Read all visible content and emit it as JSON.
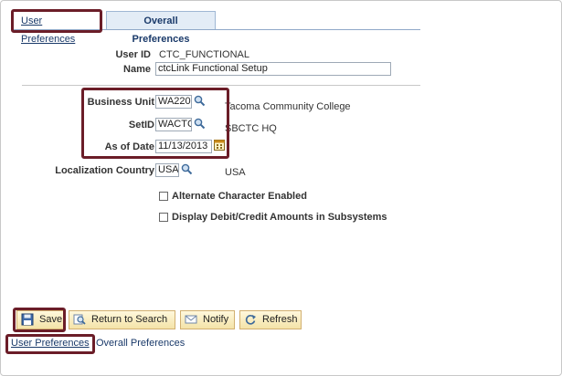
{
  "tabs": {
    "user_preferences": "User Preferences",
    "overall_preferences": "Overall Preferences"
  },
  "fields": {
    "user_id_label": "User ID",
    "user_id_value": "CTC_FUNCTIONAL",
    "name_label": "Name",
    "name_value": "ctcLink Functional Setup",
    "business_unit_label": "Business Unit",
    "business_unit_value": "WA220",
    "business_unit_desc": "Tacoma Community College",
    "setid_label": "SetID",
    "setid_value": "WACTC",
    "setid_desc": "SBCTC HQ",
    "as_of_date_label": "As of Date",
    "as_of_date_value": "11/13/2013",
    "localization_label": "Localization Country",
    "localization_value": "USA",
    "localization_desc": "USA"
  },
  "checkboxes": {
    "alt_char": "Alternate Character Enabled",
    "debit_credit": "Display Debit/Credit Amounts in Subsystems"
  },
  "toolbar": {
    "save": "Save",
    "return_to_search": "Return to Search",
    "notify": "Notify",
    "refresh": "Refresh"
  },
  "footer_links": {
    "user_preferences": "User Preferences",
    "overall_preferences": "Overall Preferences"
  },
  "colors": {
    "highlight": "#6b1d28",
    "link": "#1a3a6a",
    "button_bg": "#f4e3a8"
  }
}
